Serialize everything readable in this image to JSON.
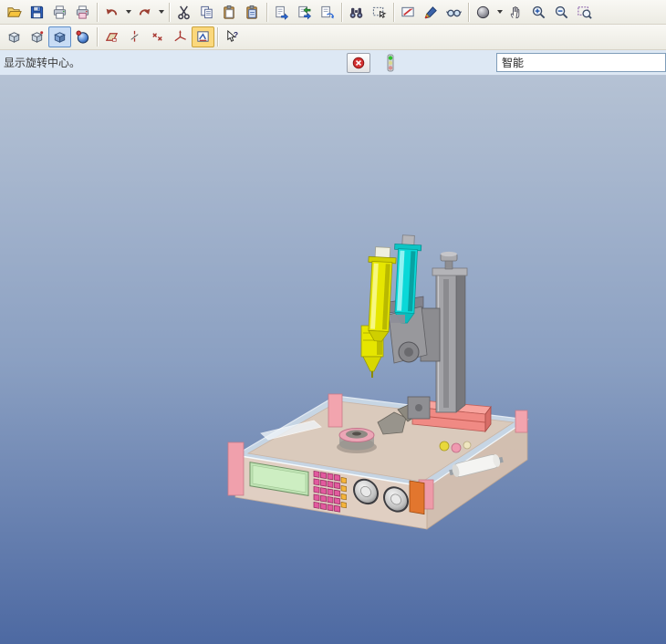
{
  "message_bar": {
    "message": "显示旋转中心。",
    "buttons": [
      "stop",
      "regeneration-status"
    ],
    "selection_filter": {
      "value": "智能"
    }
  },
  "toolbar_main": {
    "icons": [
      "open",
      "save",
      "print",
      "print-setup",
      "undo",
      "redo",
      "cut",
      "copy",
      "paste",
      "paste-special",
      "import-list",
      "update-list",
      "sync-list",
      "find",
      "select-box",
      "redline",
      "pen",
      "spectacles",
      "appearance-sphere",
      "pan-hand",
      "zoom-in",
      "zoom-out",
      "refit"
    ]
  },
  "toolbar_view": {
    "icons": [
      "default-view",
      "saved-views",
      "shaded-display",
      "render",
      "datum-plane-display",
      "datum-axis-display",
      "datum-point-display",
      "csys-display",
      "annotation-display",
      "context-help"
    ],
    "active": [
      "shaded-display",
      "annotation-display"
    ],
    "help_glyph": "?"
  },
  "viewport": {
    "background_gradient": [
      "#b5c2d4",
      "#8ba0c2",
      "#4d69a2"
    ],
    "model_colors": {
      "base_front": "#e8d4c4",
      "base_side": "#d8c2b0",
      "rim": "#cfdde9",
      "corner_posts": "#f0a0ac",
      "lcd": "#bfe3b4",
      "keypad": "#e25a9e",
      "syringe_yellow": "#e6e600",
      "syringe_cyan": "#0ad8d8",
      "column": "#a4a4a8",
      "slide": "#f08a84",
      "power_module": "#e2762e"
    }
  }
}
